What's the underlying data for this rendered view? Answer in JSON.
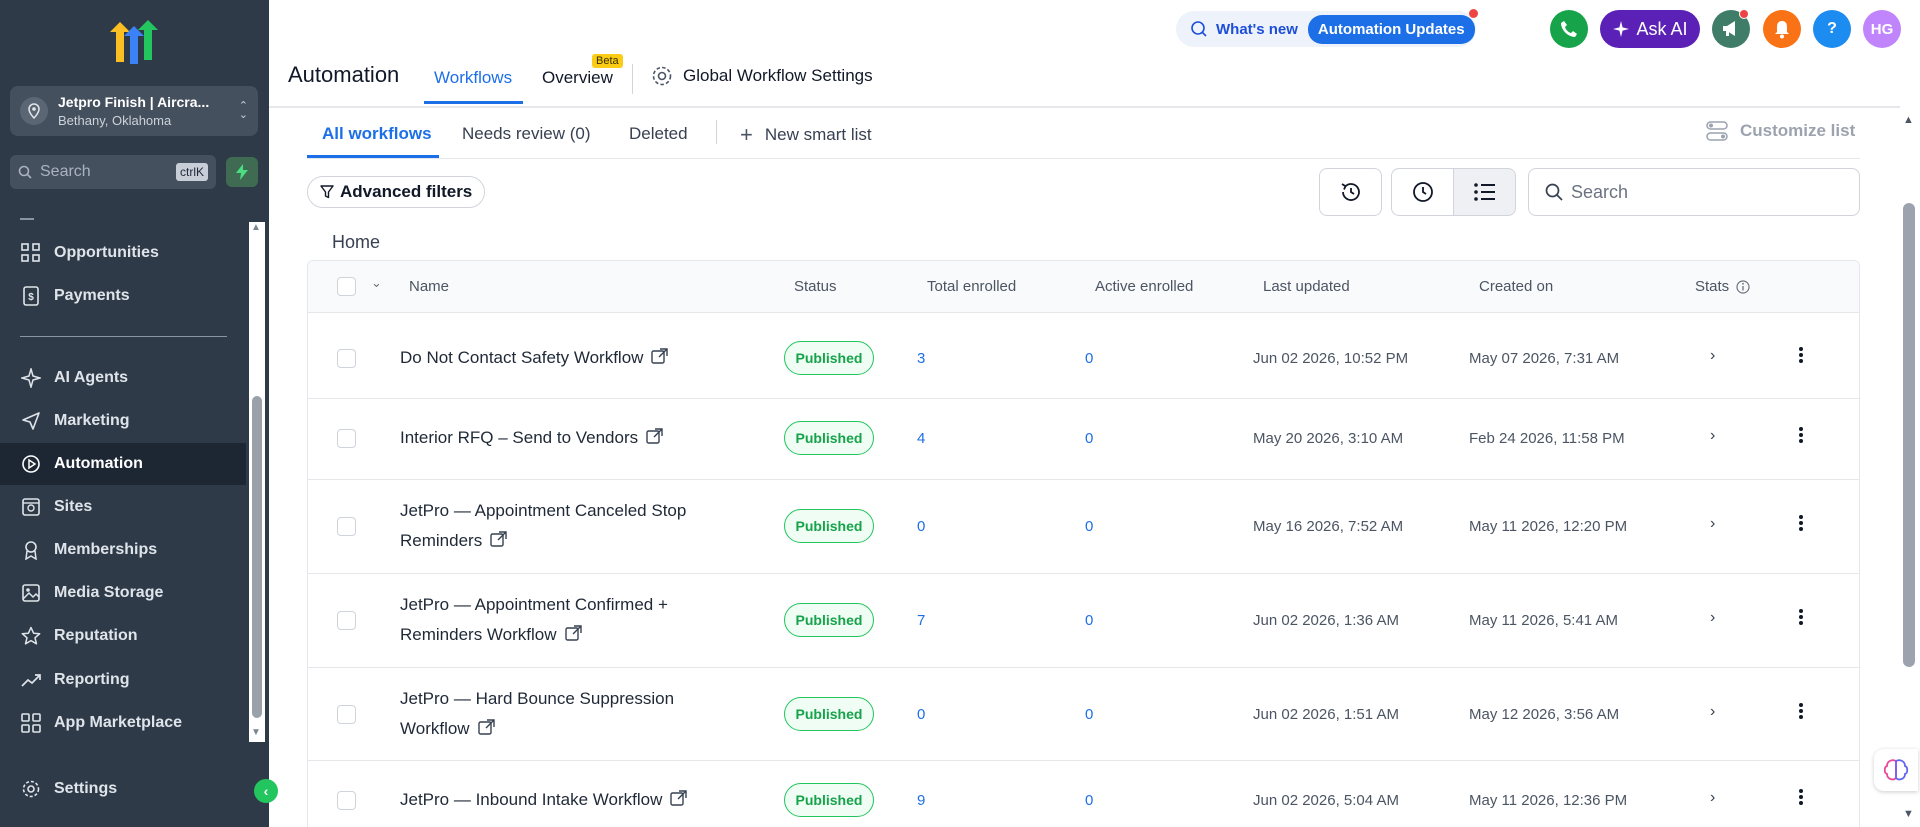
{
  "sidebar": {
    "account": {
      "name": "Jetpro Finish | Aircra...",
      "location": "Bethany, Oklahoma"
    },
    "search": {
      "placeholder": "Search",
      "shortcut": "ctrlK"
    },
    "items": [
      {
        "label": "Opportunities",
        "icon": "opportunities-icon"
      },
      {
        "label": "Payments",
        "icon": "payments-icon"
      },
      {
        "label": "AI Agents",
        "icon": "ai-agents-icon"
      },
      {
        "label": "Marketing",
        "icon": "marketing-icon"
      },
      {
        "label": "Automation",
        "icon": "automation-icon",
        "active": true
      },
      {
        "label": "Sites",
        "icon": "sites-icon"
      },
      {
        "label": "Memberships",
        "icon": "memberships-icon"
      },
      {
        "label": "Media Storage",
        "icon": "media-storage-icon"
      },
      {
        "label": "Reputation",
        "icon": "reputation-icon"
      },
      {
        "label": "Reporting",
        "icon": "reporting-icon"
      },
      {
        "label": "App Marketplace",
        "icon": "app-marketplace-icon"
      }
    ],
    "settings_label": "Settings"
  },
  "header": {
    "whats_new": "What's new",
    "automation_updates": "Automation Updates",
    "ask_ai": "Ask AI",
    "avatar": "HG",
    "help": "?"
  },
  "page": {
    "title": "Automation",
    "tabs": [
      "Workflows",
      "Overview"
    ],
    "beta": "Beta",
    "global_settings": "Global Workflow Settings"
  },
  "subtabs": {
    "items": [
      "All workflows",
      "Needs review (0)",
      "Deleted"
    ],
    "new_smart_list": "New smart list",
    "customize_list": "Customize list"
  },
  "toolbar": {
    "advanced_filters": "Advanced filters",
    "search_placeholder": "Search",
    "breadcrumb": "Home"
  },
  "table": {
    "columns": [
      "Name",
      "Status",
      "Total enrolled",
      "Active enrolled",
      "Last updated",
      "Created on",
      "Stats"
    ],
    "rows": [
      {
        "name": "Do Not Contact Safety Workflow",
        "status": "Published",
        "total": "3",
        "active": "0",
        "updated": "Jun 02 2026, 10:52 PM",
        "created": "May 07 2026, 7:31 AM"
      },
      {
        "name": "Interior RFQ – Send to Vendors",
        "status": "Published",
        "total": "4",
        "active": "0",
        "updated": "May 20 2026, 3:10 AM",
        "created": "Feb 24 2026, 11:58 PM"
      },
      {
        "name": "JetPro — Appointment Canceled Stop Reminders",
        "status": "Published",
        "total": "0",
        "active": "0",
        "updated": "May 16 2026, 7:52 AM",
        "created": "May 11 2026, 12:20 PM"
      },
      {
        "name": "JetPro — Appointment Confirmed + Reminders Workflow",
        "status": "Published",
        "total": "7",
        "active": "0",
        "updated": "Jun 02 2026, 1:36 AM",
        "created": "May 11 2026, 5:41 AM"
      },
      {
        "name": "JetPro — Hard Bounce Suppression Workflow",
        "status": "Published",
        "total": "0",
        "active": "0",
        "updated": "Jun 02 2026, 1:51 AM",
        "created": "May 12 2026, 3:56 AM"
      },
      {
        "name": "JetPro — Inbound Intake Workflow",
        "status": "Published",
        "total": "9",
        "active": "0",
        "updated": "Jun 02 2026, 5:04 AM",
        "created": "May 11 2026, 12:36 PM"
      }
    ]
  },
  "colors": {
    "sidebar_bg": "#2f3a48",
    "accent": "#1d6fe8",
    "published": "#16a34a",
    "ask_ai": "#5b21b6"
  }
}
